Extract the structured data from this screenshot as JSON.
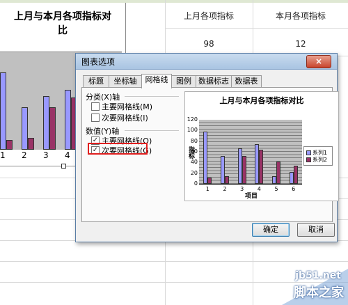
{
  "sheet": {
    "title_line1": "上月与本月各项指标对",
    "title_line2": "比",
    "header_last_month": "上月各项指标",
    "header_this_month": "本月各项指标",
    "value_last_month": "98",
    "value_this_month": "12",
    "embedded_chart": {
      "categories": [
        "1",
        "2",
        "3",
        "4"
      ],
      "series1_values": [
        95,
        52,
        66,
        74
      ],
      "series2_values": [
        12,
        15,
        52,
        64
      ]
    }
  },
  "dialog": {
    "title": "图表选项",
    "close_label": "×",
    "tabs": [
      {
        "label": "标题"
      },
      {
        "label": "坐标轴"
      },
      {
        "label": "网格线"
      },
      {
        "label": "图例"
      },
      {
        "label": "数据标志"
      },
      {
        "label": "数据表"
      }
    ],
    "active_tab": "网格线",
    "category_axis_label": "分类(X)轴",
    "value_axis_label": "数值(Y)轴",
    "options": {
      "x_major": {
        "label": "主要网格线(M)",
        "checked": false,
        "mark": ""
      },
      "x_minor": {
        "label": "次要网格线(I)",
        "checked": false,
        "mark": ""
      },
      "y_major": {
        "label": "主要网格线(O)",
        "checked": true,
        "mark": "✓"
      },
      "y_minor": {
        "label": "次要网格线(G)",
        "checked": true,
        "mark": "✓"
      }
    },
    "ok_label": "确定",
    "cancel_label": "取消"
  },
  "chart_data": {
    "type": "bar",
    "title": "上月与本月各项指标对比",
    "xlabel": "项目",
    "ylabel": "指标",
    "categories": [
      "1",
      "2",
      "3",
      "4",
      "5",
      "6"
    ],
    "series": [
      {
        "name": "系列1",
        "values": [
          98,
          52,
          66,
          74,
          14,
          22
        ],
        "color": "#9999ff"
      },
      {
        "name": "系列2",
        "values": [
          12,
          15,
          52,
          64,
          42,
          34
        ],
        "color": "#993366"
      }
    ],
    "ylim": [
      0,
      120
    ],
    "yticks": [
      "0",
      "20",
      "40",
      "60",
      "80",
      "100",
      "120"
    ],
    "grid": "major and minor horizontal",
    "legend": "right"
  },
  "watermark": {
    "url": "jb51.net",
    "name": "脚本之家"
  }
}
